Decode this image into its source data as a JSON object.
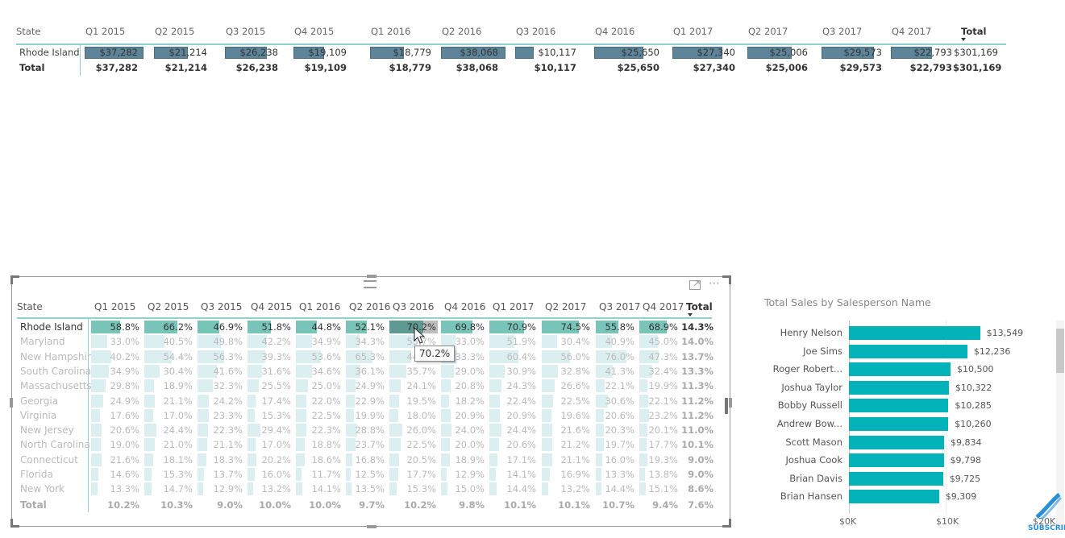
{
  "top_matrix": {
    "columns": [
      "State",
      "Q1 2015",
      "Q2 2015",
      "Q3 2015",
      "Q4 2015",
      "Q1 2016",
      "Q2 2016",
      "Q3 2016",
      "Q4 2016",
      "Q1 2017",
      "Q2 2017",
      "Q3 2017",
      "Q4 2017",
      "Total"
    ],
    "rows": [
      {
        "label": "Rhode Island",
        "values": [
          "$37,282",
          "$21,214",
          "$26,238",
          "$19,109",
          "$18,779",
          "$38,068",
          "$10,117",
          "$25,650",
          "$27,340",
          "$25,006",
          "$29,573",
          "$22,793",
          "$301,169"
        ],
        "raw": [
          37282,
          21214,
          26238,
          19109,
          18779,
          38068,
          10117,
          25650,
          27340,
          25006,
          29573,
          22793
        ]
      }
    ],
    "total": {
      "label": "Total",
      "values": [
        "$37,282",
        "$21,214",
        "$26,238",
        "$19,109",
        "$18,779",
        "$38,068",
        "$10,117",
        "$25,650",
        "$27,340",
        "$25,006",
        "$29,573",
        "$22,793",
        "$301,169"
      ]
    },
    "sort_indicator": "Total"
  },
  "bottom_matrix": {
    "columns": [
      "State",
      "Q1 2015",
      "Q2 2015",
      "Q3 2015",
      "Q4 2015",
      "Q1 2016",
      "Q2 2016",
      "Q3 2016",
      "Q4 2016",
      "Q1 2017",
      "Q2 2017",
      "Q3 2017",
      "Q4 2017",
      "Total"
    ],
    "rows": [
      {
        "label": "Rhode Island",
        "values": [
          "58.8%",
          "66.2%",
          "46.9%",
          "51.8%",
          "44.8%",
          "52.1%",
          "70.2%",
          "69.8%",
          "70.9%",
          "74.5%",
          "55.8%",
          "68.9%",
          "14.3%"
        ],
        "highlighted": true
      },
      {
        "label": "Maryland",
        "values": [
          "33.0%",
          "40.5%",
          "49.8%",
          "42.2%",
          "34.9%",
          "34.3%",
          "55.7%",
          "33.0%",
          "51.9%",
          "30.4%",
          "40.9%",
          "45.0%",
          "14.0%"
        ]
      },
      {
        "label": "New Hampshire",
        "values": [
          "40.2%",
          "54.4%",
          "56.3%",
          "39.3%",
          "53.6%",
          "65.3%",
          "44.5%",
          "33.3%",
          "60.4%",
          "56.0%",
          "76.0%",
          "47.3%",
          "13.7%"
        ]
      },
      {
        "label": "South Carolina",
        "values": [
          "34.9%",
          "30.4%",
          "41.6%",
          "31.6%",
          "34.6%",
          "36.1%",
          "35.7%",
          "29.0%",
          "30.9%",
          "32.8%",
          "41.3%",
          "32.4%",
          "13.3%"
        ]
      },
      {
        "label": "Massachusetts",
        "values": [
          "29.8%",
          "18.9%",
          "32.3%",
          "25.5%",
          "25.0%",
          "24.9%",
          "24.1%",
          "20.8%",
          "24.3%",
          "26.6%",
          "22.1%",
          "19.9%",
          "11.3%"
        ]
      },
      {
        "label": "Georgia",
        "values": [
          "24.9%",
          "21.1%",
          "24.2%",
          "17.4%",
          "22.0%",
          "22.9%",
          "19.5%",
          "18.2%",
          "22.4%",
          "22.5%",
          "30.6%",
          "22.1%",
          "11.2%"
        ]
      },
      {
        "label": "Virginia",
        "values": [
          "17.6%",
          "17.0%",
          "23.3%",
          "15.3%",
          "22.5%",
          "19.9%",
          "18.0%",
          "20.9%",
          "20.9%",
          "19.6%",
          "20.6%",
          "23.2%",
          "11.2%"
        ]
      },
      {
        "label": "New Jersey",
        "values": [
          "20.6%",
          "24.4%",
          "22.3%",
          "29.4%",
          "22.3%",
          "28.8%",
          "26.0%",
          "24.0%",
          "24.4%",
          "21.6%",
          "20.3%",
          "20.1%",
          "11.0%"
        ]
      },
      {
        "label": "North Carolina",
        "values": [
          "19.0%",
          "21.0%",
          "21.1%",
          "17.0%",
          "18.8%",
          "23.7%",
          "22.5%",
          "20.0%",
          "20.6%",
          "21.2%",
          "19.7%",
          "17.7%",
          "10.1%"
        ]
      },
      {
        "label": "Connecticut",
        "values": [
          "21.6%",
          "18.1%",
          "18.3%",
          "20.2%",
          "18.6%",
          "16.8%",
          "20.5%",
          "18.9%",
          "17.1%",
          "21.1%",
          "16.0%",
          "19.3%",
          "9.0%"
        ]
      },
      {
        "label": "Florida",
        "values": [
          "14.6%",
          "15.3%",
          "13.7%",
          "16.0%",
          "11.7%",
          "12.5%",
          "17.7%",
          "12.9%",
          "14.1%",
          "16.9%",
          "13.3%",
          "13.8%",
          "9.0%"
        ]
      },
      {
        "label": "New York",
        "values": [
          "13.3%",
          "14.7%",
          "12.9%",
          "13.2%",
          "14.1%",
          "13.5%",
          "15.3%",
          "15.0%",
          "14.4%",
          "13.2%",
          "14.4%",
          "15.1%",
          "8.6%"
        ]
      }
    ],
    "total": {
      "label": "Total",
      "values": [
        "10.2%",
        "10.3%",
        "9.0%",
        "10.0%",
        "10.0%",
        "9.7%",
        "10.2%",
        "9.8%",
        "10.1%",
        "10.1%",
        "10.7%",
        "9.4%",
        "7.6%"
      ]
    },
    "hovered_cell": {
      "row": "Rhode Island",
      "column": "Q3 2016"
    },
    "tooltip": "70.2%",
    "toolbar": {
      "focus_mode": "focus-mode-icon",
      "more_options": "⋯"
    }
  },
  "bar_chart": {
    "title": "Total Sales by Salesperson Name",
    "chart_data": {
      "type": "bar",
      "orientation": "horizontal",
      "title": "Total Sales by Salesperson Name",
      "categories": [
        "Henry Nelson",
        "Joe Sims",
        "Roger Robert...",
        "Joshua Taylor",
        "Bobby Russell",
        "Andrew Bow...",
        "Scott Mason",
        "Joshua Cook",
        "Brian Davis",
        "Brian Hansen"
      ],
      "values": [
        13549,
        12236,
        10500,
        10322,
        10285,
        10260,
        9834,
        9798,
        9725,
        9309
      ],
      "labels": [
        "$13,549",
        "$12,236",
        "$10,500",
        "$10,322",
        "$10,285",
        "$10,260",
        "$9,834",
        "$9,798",
        "$9,725",
        "$9,309"
      ],
      "xticks": [
        "$0K",
        "$10K",
        "$20K"
      ],
      "xlim": [
        0,
        20000
      ],
      "color": "#01b3b8"
    }
  },
  "watermark": {
    "text": "SUBSCRIB",
    "icon": "dna-icon"
  }
}
